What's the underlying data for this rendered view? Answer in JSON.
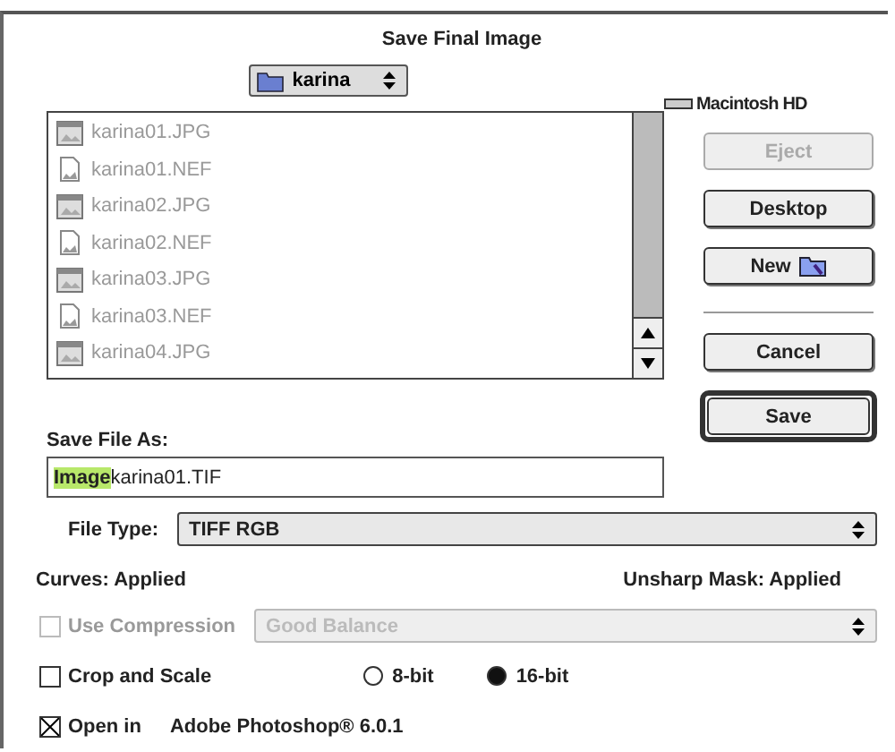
{
  "dialog": {
    "title": "Save Final Image"
  },
  "folder_popup": {
    "label": "karina"
  },
  "volume": {
    "label": "Macintosh HD"
  },
  "files": [
    {
      "name": "karina01.JPG",
      "kind": "jpg",
      "disabled": true
    },
    {
      "name": "karina01.NEF",
      "kind": "raw",
      "disabled": true
    },
    {
      "name": "karina02.JPG",
      "kind": "jpg",
      "disabled": true
    },
    {
      "name": "karina02.NEF",
      "kind": "raw",
      "disabled": true
    },
    {
      "name": "karina03.JPG",
      "kind": "jpg",
      "disabled": true
    },
    {
      "name": "karina03.NEF",
      "kind": "raw",
      "disabled": true
    },
    {
      "name": "karina04.JPG",
      "kind": "jpg",
      "disabled": true
    }
  ],
  "side_buttons": [
    {
      "label": "Eject",
      "kind": "plain",
      "disabled": true
    },
    {
      "label": "Desktop",
      "kind": "plain",
      "disabled": false
    },
    {
      "label": "New",
      "kind": "folder",
      "disabled": false
    },
    {
      "label": "Cancel",
      "kind": "plain",
      "disabled": false
    },
    {
      "label": "Save",
      "kind": "default",
      "disabled": false
    }
  ],
  "save_as": {
    "label": "Save File As:",
    "selected_part": "Image",
    "rest": "karina01.TIF"
  },
  "file_type": {
    "label": "File Type:",
    "value": "TIFF RGB"
  },
  "status": {
    "left": "Curves: Applied",
    "right": "Unsharp Mask: Applied"
  },
  "compression": {
    "label": "Use Compression",
    "checked": false,
    "disabled": true,
    "value": "Good Balance"
  },
  "crop": {
    "label": "Crop and Scale",
    "checked": false,
    "disabled": false
  },
  "bit_depth": [
    {
      "label": "8-bit",
      "selected": false
    },
    {
      "label": "16-bit",
      "selected": true
    }
  ],
  "open_in": {
    "label": "Open in",
    "checked": true,
    "disabled": false,
    "app": "Adobe Photoshop® 6.0.1"
  }
}
